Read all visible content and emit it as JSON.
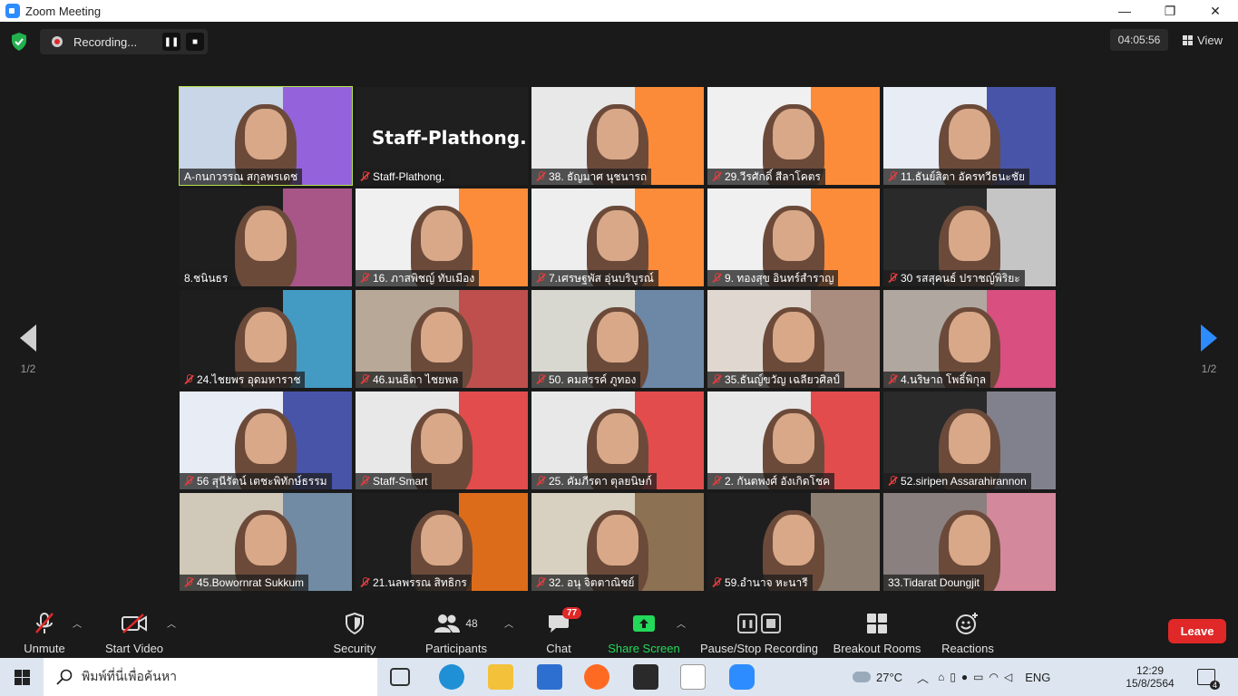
{
  "window": {
    "title": "Zoom Meeting",
    "minimize": "—",
    "restore": "❐",
    "close": "✕"
  },
  "recording": {
    "label": "Recording...",
    "pause_icon": "❚❚",
    "stop_icon": "■"
  },
  "timer": "04:05:56",
  "view_label": "View",
  "pager": {
    "left": "1/2",
    "right": "1/2"
  },
  "tiles": [
    {
      "name": "A-กนกวรรณ สกุลพรเดช",
      "muted": false,
      "active": true,
      "bg": "#c9d6e8",
      "accent": "#8b4fd8"
    },
    {
      "name": "Staff-Plathong.",
      "muted": true,
      "bg": "#1f1f1f",
      "big": "Staff-Plathong."
    },
    {
      "name": "38. ธัญมาศ นุชนารถ",
      "muted": true,
      "bg": "#e8e8e8",
      "accent": "#ff7a1a"
    },
    {
      "name": "29.วีรศักดิ์ สีลาโคตร",
      "muted": true,
      "bg": "#f0f0f0",
      "accent": "#ff7a1a"
    },
    {
      "name": "11.ธันย์สิตา อัครทวีธนะชัย",
      "muted": true,
      "bg": "#e8ecf4",
      "accent": "#2a3a9a"
    },
    {
      "name": "8.ชนินธร",
      "muted": false,
      "bg": "#1e1e1e",
      "accent": "#c0609a"
    },
    {
      "name": "16. ภาสพิชญ์ ทับเมือง",
      "muted": true,
      "bg": "#f0f0f0",
      "accent": "#ff7a1a"
    },
    {
      "name": "7.เศรษฐพัส อุ่นบริบูรณ์",
      "muted": true,
      "bg": "#eeeeee",
      "accent": "#ff7a1a"
    },
    {
      "name": "9. ทองสุข อินทร์สำราญ",
      "muted": true,
      "bg": "#f0f0f0",
      "accent": "#ff7a1a"
    },
    {
      "name": "30 รสสุคนธ์ ปราชญ์พิริยะ",
      "muted": true,
      "bg": "#2a2a2a",
      "accent": "#e0e0e0"
    },
    {
      "name": "24.ไชยพร อุดมหาราช",
      "muted": true,
      "bg": "#1e1e1e",
      "accent": "#4ab0e0"
    },
    {
      "name": "46.มนธิดา ไชยพล",
      "muted": true,
      "bg": "#b8a898",
      "accent": "#c04040"
    },
    {
      "name": "50. คมสรรค์ ภูทอง",
      "muted": true,
      "bg": "#d8d8d0",
      "accent": "#5a7aa0"
    },
    {
      "name": "35.ธันญ์ขวัญ เฉลียวศิลป์",
      "muted": true,
      "bg": "#e0d8d0",
      "accent": "#a08070"
    },
    {
      "name": "4.นริษาถ โพธิ์พิกุล",
      "muted": true,
      "bg": "#b0a8a0",
      "accent": "#e0407a"
    },
    {
      "name": "56 สุนีรัตน์ เตชะพิทักษ์ธรรม",
      "muted": true,
      "bg": "#e8ecf4",
      "accent": "#2a3a9a"
    },
    {
      "name": "Staff-Smart",
      "muted": true,
      "bg": "#e8e8e8",
      "accent": "#e03030"
    },
    {
      "name": "25. คัมภีรดา ตุลยนิษก์",
      "muted": true,
      "bg": "#e8e8e8",
      "accent": "#e03030"
    },
    {
      "name": "2. กันตพงศ์ อังเกิดโชค",
      "muted": true,
      "bg": "#e8e8e8",
      "accent": "#e03030"
    },
    {
      "name": "52.siripen Assarahirannon",
      "muted": true,
      "bg": "#2a2a2a",
      "accent": "#9090a0"
    },
    {
      "name": "45.Bowornrat Sukkum",
      "muted": true,
      "bg": "#d0c8b8",
      "accent": "#6080a0"
    },
    {
      "name": "21.นลพรรณ สิทธิกร",
      "muted": true,
      "bg": "#1e1e1e",
      "accent": "#ff7a1a"
    },
    {
      "name": "32. อนุ จิตตาณิชย์",
      "muted": true,
      "bg": "#d8d0c0",
      "accent": "#806040"
    },
    {
      "name": "59.อำนาจ หะนารี",
      "muted": true,
      "bg": "#1e1e1e",
      "accent": "#a09080"
    },
    {
      "name": "33.Tidarat Doungjit",
      "muted": false,
      "bg": "#8a8080",
      "accent": "#e08aa0"
    }
  ],
  "toolbar": {
    "unmute": "Unmute",
    "start_video": "Start Video",
    "security": "Security",
    "participants": "Participants",
    "participants_count": "48",
    "chat": "Chat",
    "chat_badge": "77",
    "share_screen": "Share Screen",
    "pause_stop": "Pause/Stop Recording",
    "breakout": "Breakout Rooms",
    "reactions": "Reactions",
    "leave": "Leave"
  },
  "taskbar": {
    "search_placeholder": "พิมพ์ที่นี่เพื่อค้นหา",
    "weather": "27°C",
    "lang": "ENG",
    "time": "12:29",
    "date": "15/8/2564",
    "notifications": "4"
  },
  "colors": {
    "accent": "#2d8cff",
    "leave": "#e02828",
    "share": "#23d959",
    "active_border": "#b6e34b"
  }
}
